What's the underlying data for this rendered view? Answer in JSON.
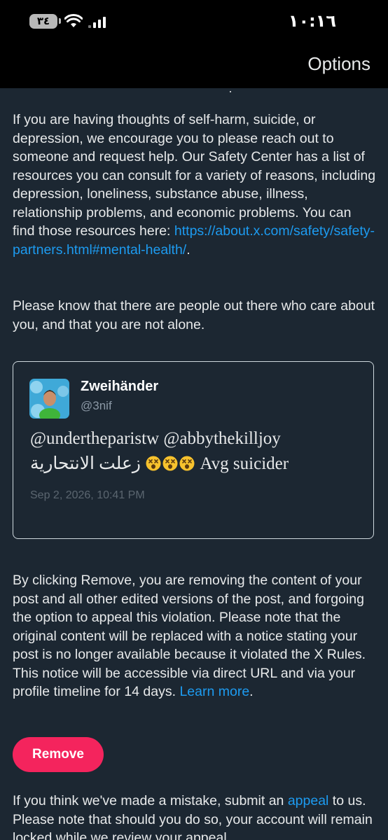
{
  "status_bar": {
    "time": "١٠:١٦",
    "battery": "٣٤"
  },
  "nav": {
    "options_label": "Options"
  },
  "body": {
    "cut_text": "·",
    "para1_text": "If you are having thoughts of self-harm, suicide, or depression, we encourage you to please reach out to someone and request help. Our Safety Center has a list of resources you can consult for a variety of reasons, including depression, loneliness, substance abuse, illness, relationship problems, and economic problems. You can find those resources here: ",
    "para1_link": "https://about.x.com/safety/safety-partners.html#mental-health/",
    "para1_end": ".",
    "para2_text": "Please know that there are people out there who care about you, and that you are not alone.",
    "para3_text": "By clicking Remove, you are removing the content of your post and all other edited versions of the post, and forgoing the option to appeal this violation. Please note that the original content will be replaced with a notice stating your post is no longer available because it violated the X Rules. This notice will be accessible via direct URL and via your profile timeline for 14 days. ",
    "para3_link": "Learn more",
    "para3_end": ".",
    "remove_label": "Remove",
    "para4_start": "If you think we've made a mistake, submit an ",
    "para4_link": "appeal",
    "para4_end": " to us. Please note that should you do so, your account will remain locked while we review your appeal."
  },
  "embedded_post": {
    "display_name": "Zweihänder",
    "handle": "@3nif",
    "text_line1": "@undertheparistw @abbythekilljoy",
    "text_arabic": "زعلت الانتحارية",
    "text_end": "Avg suicider",
    "emoji_name": "dizzy-face-emoji",
    "date": "Sep 2, 2026, 10:41 PM"
  },
  "colors": {
    "background": "#1c2732",
    "text": "#e7e9ea",
    "link": "#1d9bf0",
    "remove_button": "#f4245d",
    "muted": "#8b98a5"
  }
}
